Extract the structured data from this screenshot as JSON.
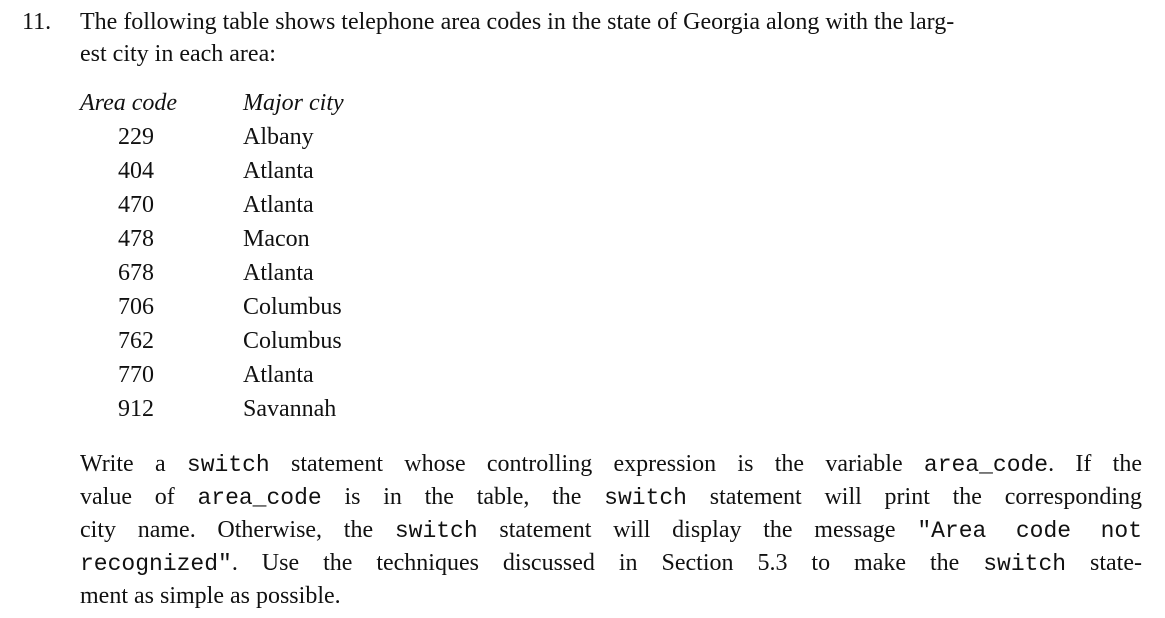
{
  "exercise": {
    "number": "11.",
    "intro_lines": [
      "The following table shows telephone area codes in the state of Georgia along with the larg-",
      "est city in each area:"
    ]
  },
  "table": {
    "headers": {
      "code": "Area code",
      "city": "Major city"
    },
    "rows": [
      {
        "code": "229",
        "city": "Albany"
      },
      {
        "code": "404",
        "city": "Atlanta"
      },
      {
        "code": "470",
        "city": "Atlanta"
      },
      {
        "code": "478",
        "city": "Macon"
      },
      {
        "code": "678",
        "city": "Atlanta"
      },
      {
        "code": "706",
        "city": "Columbus"
      },
      {
        "code": "762",
        "city": "Columbus"
      },
      {
        "code": "770",
        "city": "Atlanta"
      },
      {
        "code": "912",
        "city": "Savannah"
      }
    ]
  },
  "paragraph": {
    "l1a": "Write a ",
    "l1b": "switch",
    "l1c": " statement whose controlling expression is the variable ",
    "l1d": "area_code",
    "l1e": ". If the",
    "l2a": "value of ",
    "l2b": "area_code",
    "l2c": " is in the table, the ",
    "l2d": "switch",
    "l2e": " statement will print the corresponding",
    "l3a": "city name. Otherwise, the ",
    "l3b": "switch",
    "l3c": " statement will display the message ",
    "l3d": "\"Area code not",
    "l4a": "recognized\"",
    "l4b": ". Use the techniques discussed in Section 5.3 to make the ",
    "l4c": "switch",
    "l4d": " state-",
    "l5a": "ment as simple as possible."
  }
}
